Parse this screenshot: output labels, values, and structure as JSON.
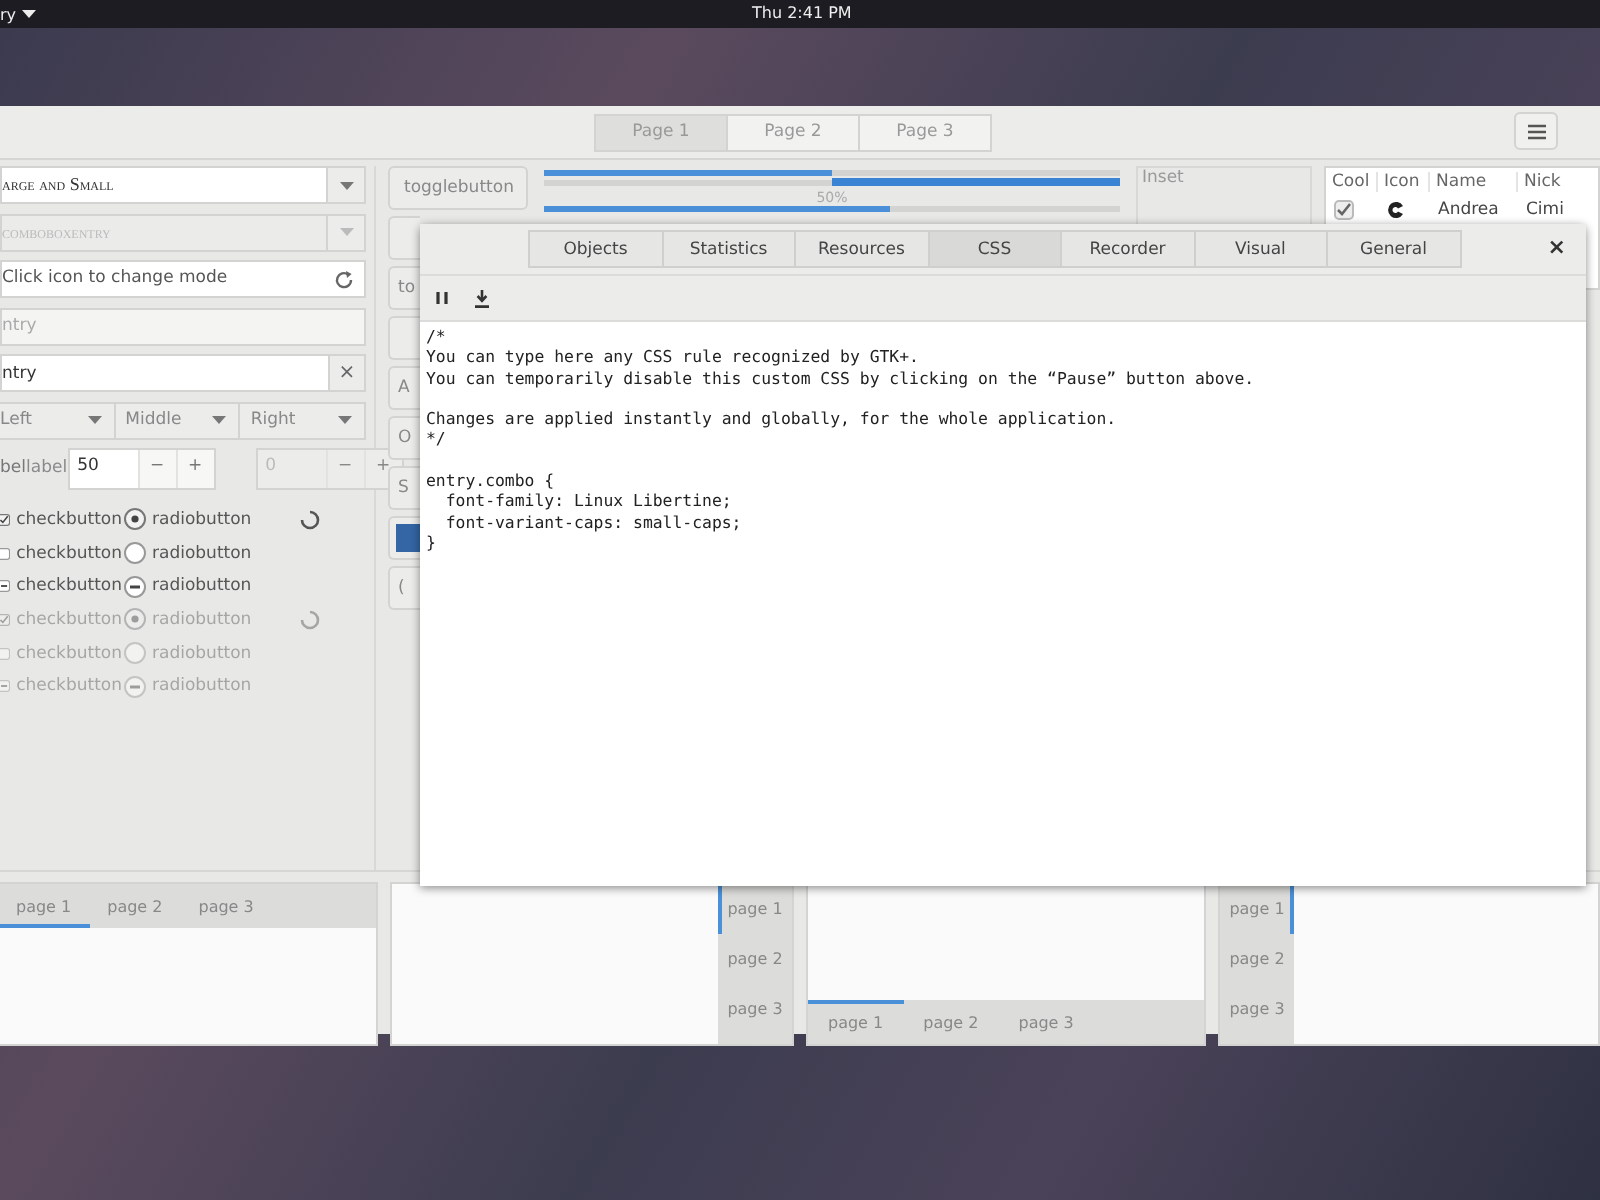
{
  "top_bar": {
    "menu": "ry",
    "clock": "Thu  2:41 PM"
  },
  "header": {
    "stack_tabs": [
      {
        "label": "Page 1",
        "selected": true
      },
      {
        "label": "Page 2",
        "selected": false
      },
      {
        "label": "Page 3",
        "selected": false
      }
    ]
  },
  "column_1": {
    "combo_entry": {
      "value": "arge and Small"
    },
    "disabled_combo": {
      "value": "comboboxentry"
    },
    "mode_entry": {
      "value": "Click icon to change mode"
    },
    "placeholder_entry": {
      "placeholder": "ntry"
    },
    "clear_entry": {
      "value": "ntry",
      "clear": "×"
    },
    "combos": [
      {
        "label": "Left"
      },
      {
        "label": "Middle"
      },
      {
        "label": "Right"
      }
    ],
    "spin_row": {
      "label_1": "bel",
      "label_2": "label",
      "spin": {
        "value": "50",
        "minus": "−",
        "plus": "+"
      },
      "disabled_spin": {
        "value": "0",
        "minus": "−",
        "plus": "+"
      }
    },
    "check_rows": [
      {
        "check": {
          "label": "checkbutton",
          "checked": true,
          "inconsistent": false
        },
        "radio": {
          "label": "radiobutton",
          "checked": true,
          "inconsistent": false
        },
        "spinner": true,
        "disabled": false
      },
      {
        "check": {
          "label": "checkbutton",
          "checked": false,
          "inconsistent": false
        },
        "radio": {
          "label": "radiobutton",
          "checked": false,
          "inconsistent": false
        },
        "spinner": false,
        "disabled": false
      },
      {
        "check": {
          "label": "checkbutton",
          "checked": false,
          "inconsistent": true
        },
        "radio": {
          "label": "radiobutton",
          "checked": false,
          "inconsistent": true
        },
        "spinner": false,
        "disabled": false
      },
      {
        "check": {
          "label": "checkbutton",
          "checked": true,
          "inconsistent": false
        },
        "radio": {
          "label": "radiobutton",
          "checked": true,
          "inconsistent": false
        },
        "spinner": true,
        "disabled": true
      },
      {
        "check": {
          "label": "checkbutton",
          "checked": false,
          "inconsistent": false
        },
        "radio": {
          "label": "radiobutton",
          "checked": false,
          "inconsistent": false
        },
        "spinner": false,
        "disabled": true
      },
      {
        "check": {
          "label": "checkbutton",
          "checked": false,
          "inconsistent": true
        },
        "radio": {
          "label": "radiobutton",
          "checked": false,
          "inconsistent": true
        },
        "spinner": false,
        "disabled": true
      }
    ]
  },
  "column_2": {
    "buttons": [
      {
        "kind": "text",
        "label": "togglebutton"
      },
      {
        "kind": "text"
      },
      {
        "kind": "text",
        "label": "to"
      },
      {
        "kind": "text"
      },
      {
        "kind": "text",
        "label": "A"
      },
      {
        "kind": "text",
        "label": "O"
      },
      {
        "kind": "text",
        "label": "S"
      },
      {
        "kind": "color"
      },
      {
        "kind": "text",
        "label": "("
      }
    ]
  },
  "column_3": {
    "progress_bars": [
      {
        "level": 0.5,
        "inverted": false
      },
      {
        "level": 0.5,
        "inverted": true
      },
      {
        "level": 0.6,
        "inverted": false,
        "label": "50%"
      }
    ]
  },
  "column_4": {
    "frame_label": "Inset"
  },
  "tree": {
    "columns": [
      "Cool",
      "Icon",
      "Name",
      "Nick"
    ],
    "rows": [
      {
        "cool": true,
        "name": "Andrea",
        "nick": "Cimi"
      }
    ]
  },
  "notebooks": [
    {
      "kind": "top",
      "tabs": [
        {
          "label": "page 1",
          "selected": true
        },
        {
          "label": "page 2",
          "selected": false
        },
        {
          "label": "page 3",
          "selected": false
        }
      ]
    },
    {
      "kind": "right",
      "tabs": [
        {
          "label": "page 1",
          "selected": true
        },
        {
          "label": "page 2",
          "selected": false
        },
        {
          "label": "page 3",
          "selected": false
        }
      ]
    },
    {
      "kind": "bottom",
      "tabs": [
        {
          "label": "page 1",
          "selected": true
        },
        {
          "label": "page 2",
          "selected": false
        },
        {
          "label": "page 3",
          "selected": false
        }
      ]
    },
    {
      "kind": "left",
      "tabs": [
        {
          "label": "page 1",
          "selected": true
        },
        {
          "label": "page 2",
          "selected": false
        },
        {
          "label": "page 3",
          "selected": false
        }
      ]
    }
  ],
  "inspector": {
    "tabs": [
      {
        "label": "Objects",
        "selected": false
      },
      {
        "label": "Statistics",
        "selected": false
      },
      {
        "label": "Resources",
        "selected": false
      },
      {
        "label": "CSS",
        "selected": true
      },
      {
        "label": "Recorder",
        "selected": false
      },
      {
        "label": "Visual",
        "selected": false
      },
      {
        "label": "General",
        "selected": false
      }
    ],
    "close": "×",
    "css_text": "/*\nYou can type here any CSS rule recognized by GTK+.\nYou can temporarily disable this custom CSS by clicking on the “Pause” button above.\n\nChanges are applied instantly and globally, for the whole application.\n*/\n\nentry.combo {\n  font-family: Linux Libertine;\n  font-variant-caps: small-caps;\n}"
  }
}
